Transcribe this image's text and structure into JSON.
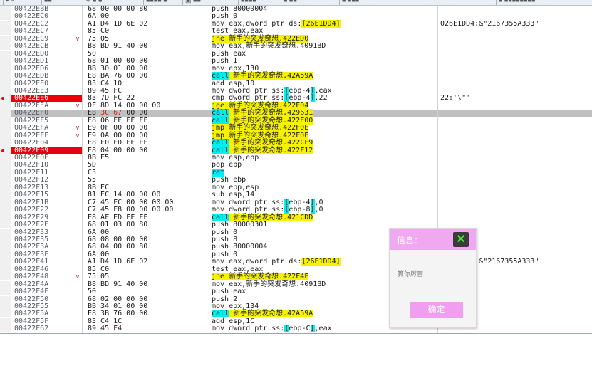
{
  "toolbar": {
    "items": [
      "▸ ✓",
      "■■",
      "※ ■ ■",
      "■■■■ ■",
      "▣ ■■",
      "■■■■",
      "■ ■■",
      "■ ■■■",
      "■ ■■■■■■■■"
    ]
  },
  "disasm": {
    "rows": [
      {
        "addr": "00422EBB",
        "bytes": "68 00 00 00 80",
        "ins": [
          {
            "t": "push 80000004"
          }
        ],
        "cmt": ""
      },
      {
        "addr": "00422EC0",
        "bytes": "6A 00",
        "ins": [
          {
            "t": "push 0"
          }
        ],
        "cmt": ""
      },
      {
        "addr": "00422EC2",
        "bytes": "A1 D4 1D 6E 02",
        "ins": [
          {
            "t": "mov eax,dword ptr "
          },
          {
            "t": "ds:",
            "s": "num"
          },
          {
            "t": "[26E1DD4]",
            "s": "y"
          }
        ],
        "cmt": "026E1DD4:&\"2167355A333\""
      },
      {
        "addr": "00422EC7",
        "bytes": "85 C0",
        "ins": [
          {
            "t": "test eax,eax"
          }
        ],
        "cmt": ""
      },
      {
        "addr": "00422EC9",
        "arrow": "v",
        "bytes": "75 05",
        "ins": [
          {
            "t": "jne 新手的突发奇想.422ED0",
            "s": "y"
          }
        ],
        "cmt": ""
      },
      {
        "addr": "00422ECB",
        "bytes": "B8 BD 91 40 00",
        "ins": [
          {
            "t": "mov eax,新手的突发奇想.4091BD"
          }
        ],
        "cmt": ""
      },
      {
        "addr": "00422ED0",
        "bytes": "50",
        "ins": [
          {
            "t": "push eax"
          }
        ],
        "cmt": ""
      },
      {
        "addr": "00422ED1",
        "bytes": "68 01 00 00 00",
        "ins": [
          {
            "t": "push 1"
          }
        ],
        "cmt": ""
      },
      {
        "addr": "00422ED6",
        "bytes": "BB 30 01 00 00",
        "ins": [
          {
            "t": "mov ebx,130"
          }
        ],
        "cmt": ""
      },
      {
        "addr": "00422EDB",
        "bytes": "E8 BA 76 00 00",
        "ins": [
          {
            "t": "call",
            "s": "c"
          },
          {
            "t": " 新手的突发奇想.42A59A",
            "s": "y"
          }
        ],
        "cmt": ""
      },
      {
        "addr": "00422EE0",
        "bytes": "83 C4 10",
        "ins": [
          {
            "t": "add esp,10"
          }
        ],
        "cmt": ""
      },
      {
        "addr": "00422EE3",
        "bytes": "89 45 FC",
        "ins": [
          {
            "t": "mov dword ptr ss:"
          },
          {
            "t": "[",
            "s": "c"
          },
          {
            "t": "ebp-4"
          },
          {
            "t": "]",
            "s": "c"
          },
          {
            "t": ",eax"
          }
        ],
        "cmt": ""
      },
      {
        "addr": "00422EE6",
        "bp": true,
        "bytes": "83 7D FC 22",
        "ins": [
          {
            "t": "cmp dword ptr ss:"
          },
          {
            "t": "[",
            "s": "c"
          },
          {
            "t": "ebp-4"
          },
          {
            "t": "]",
            "s": "c"
          },
          {
            "t": ",22"
          }
        ],
        "cmt": "22:'\\\"'"
      },
      {
        "addr": "00422EEA",
        "arrow": "v",
        "bytes": "0F 8D 14 00 00 00",
        "ins": [
          {
            "t": "jge 新手的突发奇想.422F04",
            "s": "y"
          }
        ],
        "cmt": ""
      },
      {
        "addr": "00422EF0",
        "sel": true,
        "bytes": "E8 3C 67 00 00",
        "hl": true,
        "ins": [
          {
            "t": "call",
            "s": "c"
          },
          {
            "t": " 新手的突发奇想.429631",
            "s": "y"
          }
        ],
        "cmt": ""
      },
      {
        "addr": "00422EF5",
        "bytes": "E8 06 FF FF FF",
        "ins": [
          {
            "t": "call",
            "s": "c"
          },
          {
            "t": " 新手的突发奇想.422E00",
            "s": "y"
          }
        ],
        "cmt": ""
      },
      {
        "addr": "00422EFA",
        "arrow": "v",
        "bytes": "E9 0F 00 00 00",
        "ins": [
          {
            "t": "jmp 新手的突发奇想.422F0E",
            "s": "y"
          }
        ],
        "cmt": ""
      },
      {
        "addr": "00422EFF",
        "arrow": "v",
        "bytes": "E9 0A 00 00 00",
        "ins": [
          {
            "t": "jmp 新手的突发奇想.422F0E",
            "s": "y"
          }
        ],
        "cmt": ""
      },
      {
        "addr": "00422F04",
        "bytes": "E8 F0 FD FF FF",
        "ins": [
          {
            "t": "call",
            "s": "c"
          },
          {
            "t": " 新手的突发奇想.422CF9",
            "s": "y"
          }
        ],
        "cmt": ""
      },
      {
        "addr": "00422F09",
        "bp": true,
        "bytes": "E8 04 00 00 00",
        "ins": [
          {
            "t": "call",
            "s": "c"
          },
          {
            "t": " 新手的突发奇想.422F12",
            "s": "y"
          }
        ],
        "cmt": ""
      },
      {
        "addr": "00422F0E",
        "bytes": "8B E5",
        "ins": [
          {
            "t": "mov esp,ebp"
          }
        ],
        "cmt": ""
      },
      {
        "addr": "00422F10",
        "bytes": "5D",
        "ins": [
          {
            "t": "pop ebp"
          }
        ],
        "cmt": ""
      },
      {
        "addr": "00422F11",
        "bytes": "C3",
        "ins": [
          {
            "t": "ret",
            "s": "c"
          }
        ],
        "cmt": ""
      },
      {
        "addr": "00422F12",
        "bytes": "55",
        "ins": [
          {
            "t": "push ebp"
          }
        ],
        "cmt": ""
      },
      {
        "addr": "00422F13",
        "bytes": "8B EC",
        "ins": [
          {
            "t": "mov ebp,esp"
          }
        ],
        "cmt": ""
      },
      {
        "addr": "00422F15",
        "bytes": "81 EC 14 00 00 00",
        "ins": [
          {
            "t": "sub esp,14"
          }
        ],
        "cmt": ""
      },
      {
        "addr": "00422F1B",
        "bytes": "C7 45 FC 00 00 00 00",
        "ins": [
          {
            "t": "mov dword ptr ss:"
          },
          {
            "t": "[",
            "s": "c"
          },
          {
            "t": "ebp-4"
          },
          {
            "t": "]",
            "s": "c"
          },
          {
            "t": ",0"
          }
        ],
        "cmt": ""
      },
      {
        "addr": "00422F22",
        "bytes": "C7 45 F8 00 00 00 00",
        "ins": [
          {
            "t": "mov dword ptr ss:"
          },
          {
            "t": "[",
            "s": "c"
          },
          {
            "t": "ebp-8"
          },
          {
            "t": "]",
            "s": "c"
          },
          {
            "t": ",0"
          }
        ],
        "cmt": ""
      },
      {
        "addr": "00422F29",
        "bytes": "E8 AF ED FF FF",
        "ins": [
          {
            "t": "call",
            "s": "c"
          },
          {
            "t": " 新手的突发奇想.421CDD",
            "s": "y"
          }
        ],
        "cmt": ""
      },
      {
        "addr": "00422F2E",
        "bytes": "68 01 03 00 80",
        "ins": [
          {
            "t": "push 80000301"
          }
        ],
        "cmt": ""
      },
      {
        "addr": "00422F33",
        "bytes": "6A 00",
        "ins": [
          {
            "t": "push 0"
          }
        ],
        "cmt": ""
      },
      {
        "addr": "00422F35",
        "bytes": "68 08 00 00 00",
        "ins": [
          {
            "t": "push 8"
          }
        ],
        "cmt": ""
      },
      {
        "addr": "00422F3A",
        "bytes": "68 04 00 00 80",
        "ins": [
          {
            "t": "push 80000004"
          }
        ],
        "cmt": ""
      },
      {
        "addr": "00422F3F",
        "bytes": "6A 00",
        "ins": [
          {
            "t": "push 0"
          }
        ],
        "cmt": ""
      },
      {
        "addr": "00422F41",
        "bytes": "A1 D4 1D 6E 02",
        "ins": [
          {
            "t": "mov eax,dword ptr "
          },
          {
            "t": "ds:",
            "s": "num"
          },
          {
            "t": "[26E1DD4]",
            "s": "y"
          }
        ],
        "cmt": "026E1DD4:&\"2167355A333\""
      },
      {
        "addr": "00422F46",
        "bytes": "85 C0",
        "ins": [
          {
            "t": "test eax,eax"
          }
        ],
        "cmt": ""
      },
      {
        "addr": "00422F48",
        "arrow": "v",
        "bytes": "75 05",
        "ins": [
          {
            "t": "jne 新手的突发奇想.422F4F",
            "s": "y"
          }
        ],
        "cmt": ""
      },
      {
        "addr": "00422F4A",
        "bytes": "B8 BD 91 40 00",
        "ins": [
          {
            "t": "mov eax,新手的突发奇想.4091BD"
          }
        ],
        "cmt": ""
      },
      {
        "addr": "00422F4F",
        "bytes": "50",
        "ins": [
          {
            "t": "push eax"
          }
        ],
        "cmt": ""
      },
      {
        "addr": "00422F50",
        "bytes": "68 02 00 00 00",
        "ins": [
          {
            "t": "push 2"
          }
        ],
        "cmt": ""
      },
      {
        "addr": "00422F55",
        "bytes": "BB 34 01 00 00",
        "ins": [
          {
            "t": "mov ebx,134"
          }
        ],
        "cmt": ""
      },
      {
        "addr": "00422F5A",
        "bytes": "E8 3B 76 00 00",
        "ins": [
          {
            "t": "call",
            "s": "c"
          },
          {
            "t": " 新手的突发奇想.42A59A",
            "s": "y"
          }
        ],
        "cmt": ""
      },
      {
        "addr": "00422F5F",
        "bytes": "83 C4 1C",
        "ins": [
          {
            "t": "add esp,1C"
          }
        ],
        "cmt": ""
      },
      {
        "addr": "00422F62",
        "bytes": "89 45 F4",
        "ins": [
          {
            "t": "mov dword ptr ss:"
          },
          {
            "t": "[",
            "s": "c"
          },
          {
            "t": "ebp-C"
          },
          {
            "t": "]",
            "s": "c"
          },
          {
            "t": ",eax"
          }
        ],
        "cmt": ""
      }
    ]
  },
  "dialog": {
    "title": "信息：",
    "close_symbol": "✕",
    "message": "算你厉害",
    "ok_label": "确定"
  },
  "colors": {
    "breakpoint": "#e8000b",
    "jump_highlight": "#f7f300",
    "call_highlight": "#00f0f0",
    "dialog_header": "#f0a9f0",
    "dialog_button": "#f09ff0"
  }
}
